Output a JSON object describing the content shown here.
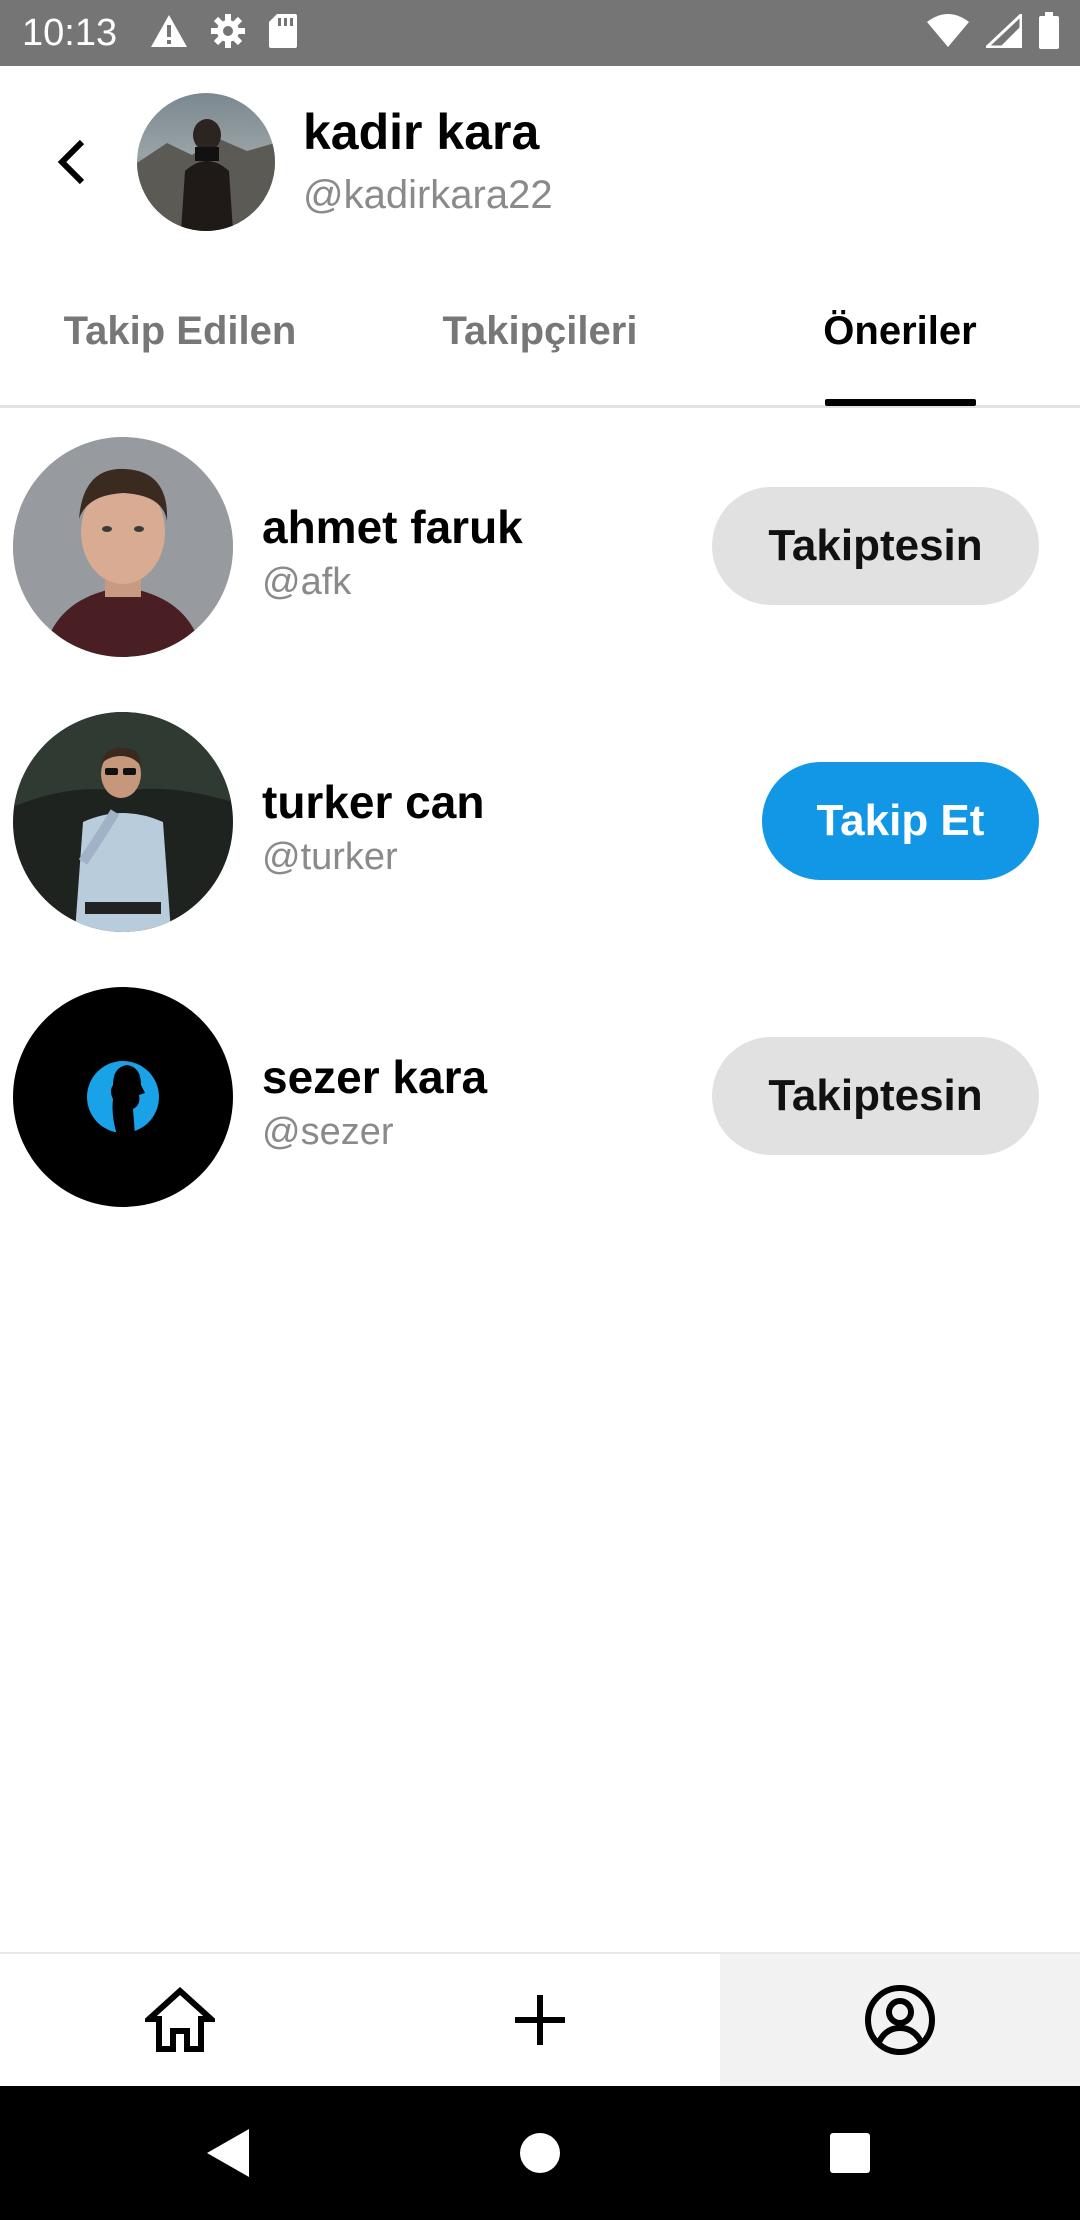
{
  "status_bar": {
    "time": "10:13",
    "left_icons": [
      "warning-icon",
      "gear-icon",
      "sd-card-icon"
    ],
    "right_icons": [
      "wifi-icon",
      "signal-icon",
      "battery-icon"
    ]
  },
  "header": {
    "back_icon": "chevron-left-icon",
    "name": "kadir kara",
    "handle": "@kadirkara22"
  },
  "tabs": [
    {
      "label": "Takip Edilen",
      "active": false
    },
    {
      "label": "Takipçileri",
      "active": false
    },
    {
      "label": "Öneriler",
      "active": true
    }
  ],
  "users": [
    {
      "name": "ahmet faruk",
      "handle": "@afk",
      "button_label": "Takiptesin",
      "following": true
    },
    {
      "name": "turker can",
      "handle": "@turker",
      "button_label": "Takip Et",
      "following": false
    },
    {
      "name": "sezer kara",
      "handle": "@sezer",
      "button_label": "Takiptesin",
      "following": true
    }
  ],
  "bottom_nav": [
    {
      "icon": "home-icon",
      "selected": false
    },
    {
      "icon": "plus-icon",
      "selected": false
    },
    {
      "icon": "profile-icon",
      "selected": true
    }
  ],
  "system_nav": [
    "back-triangle-icon",
    "home-circle-icon",
    "recents-square-icon"
  ],
  "colors": {
    "status_bar": "#757575",
    "follow_button": "#1296e6",
    "following_button": "#e1e1e1",
    "active_tab": "#000000",
    "inactive_tab": "#777777"
  }
}
